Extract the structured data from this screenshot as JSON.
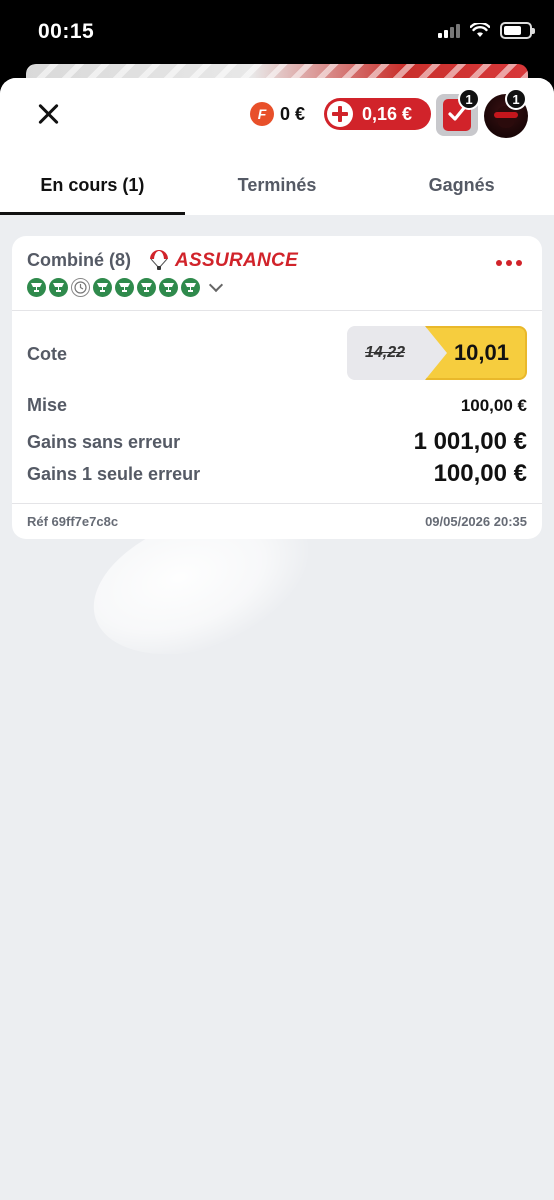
{
  "status_bar": {
    "time": "00:15"
  },
  "header": {
    "freebet_coin": "F",
    "freebet_amount": "0 €",
    "balance": "0,16 €",
    "betslip_count": "1",
    "profile_count": "1"
  },
  "tabs": [
    {
      "label": "En cours (1)",
      "active": true
    },
    {
      "label": "Terminés",
      "active": false
    },
    {
      "label": "Gagnés",
      "active": false
    }
  ],
  "bet": {
    "type_label": "Combiné (8)",
    "insurance_label": "ASSURANCE",
    "legs": [
      "won",
      "won",
      "pending",
      "won",
      "won",
      "won",
      "won",
      "won"
    ],
    "odds_label": "Cote",
    "odds_old": "14,22",
    "odds_new": "10,01",
    "stake_label": "Mise",
    "stake_value": "100,00 €",
    "win_label": "Gains sans erreur",
    "win_value": "1 001,00 €",
    "one_error_label": "Gains 1 seule erreur",
    "one_error_value": "100,00 €",
    "ref": "Réf 69ff7e7c8c",
    "date": "09/05/2026 20:35"
  },
  "colors": {
    "brand_red": "#d1232a",
    "won_green": "#2f8a4c",
    "odds_yellow": "#f6cd3e"
  }
}
